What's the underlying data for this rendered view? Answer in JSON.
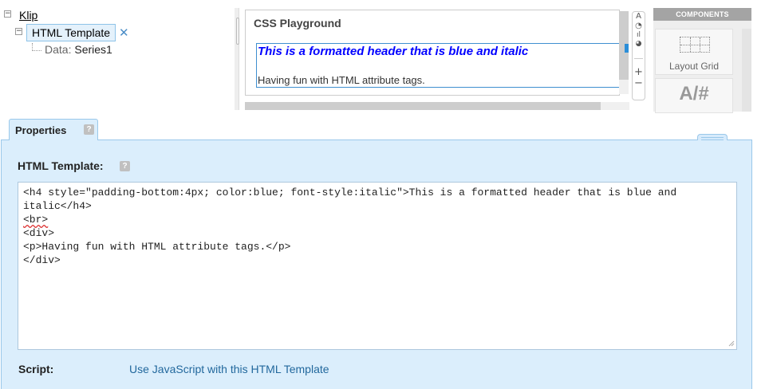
{
  "tree": {
    "root_label": "Klip",
    "component_label": "HTML Template",
    "data_label": "Data:",
    "data_value": "Series1",
    "expander_glyph": "⊟",
    "remove_glyph": "✕"
  },
  "playground": {
    "title": "CSS Playground",
    "heading_text": "This is a formatted header that is blue and italic",
    "paragraph_text": "Having fun with HTML attribute tags.",
    "heading_color": "#0000ff"
  },
  "mini_toolbar": {
    "items": [
      "A",
      "◔",
      "ıl",
      "◕",
      "+",
      "−"
    ]
  },
  "components": {
    "header": "COMPONENTS",
    "tiles": [
      {
        "label": "Layout Grid",
        "icon": "layout-grid-icon"
      },
      {
        "label": "A/#",
        "icon": "label-icon"
      }
    ]
  },
  "properties": {
    "tab_label": "Properties",
    "help_glyph": "?",
    "html_template_label": "HTML Template:",
    "editor_lines": [
      "<h4 style=\"padding-bottom:4px; color:blue; font-style:italic\">This is a formatted header that is blue and italic</h4>",
      "<br>",
      "<div>",
      "<p>Having fun with HTML attribute tags.</p>",
      "</div>"
    ],
    "script_label": "Script:",
    "script_link": "Use JavaScript with this HTML Template"
  },
  "colors": {
    "panel_bg": "#dbeefc",
    "panel_border": "#9ac8ea",
    "link": "#22689d",
    "selection_bg": "#e4f1fb"
  }
}
